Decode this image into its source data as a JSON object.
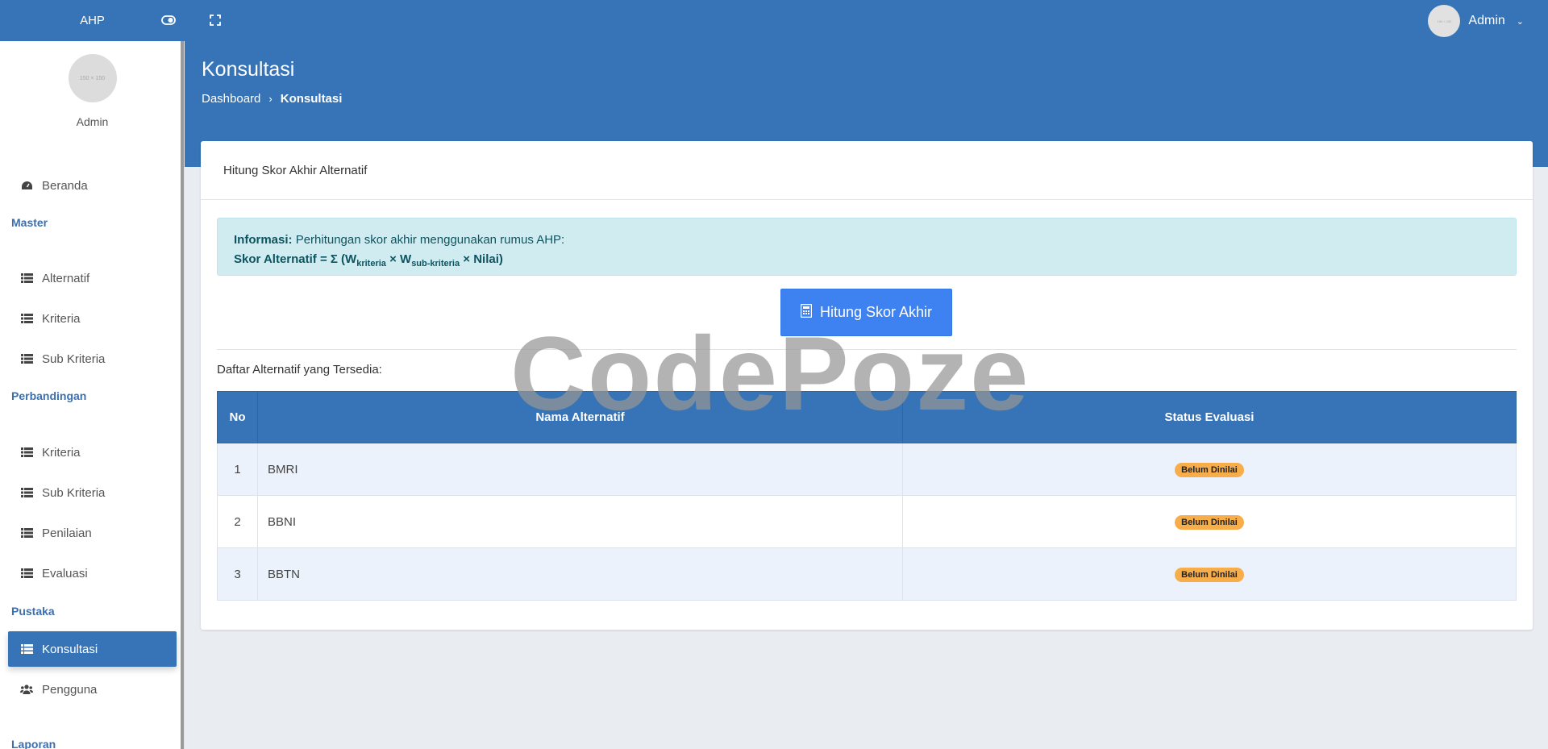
{
  "app": {
    "brand": "AHP"
  },
  "topbar": {
    "user_name": "Admin",
    "avatar_text": "150 × 150"
  },
  "sidebar": {
    "profile_avatar_text": "150 × 150",
    "profile_name": "Admin",
    "beranda": "Beranda",
    "section_master": "Master",
    "master_items": [
      "Alternatif",
      "Kriteria",
      "Sub Kriteria"
    ],
    "section_perbandingan": "Perbandingan",
    "perbandingan_items": [
      "Kriteria",
      "Sub Kriteria",
      "Penilaian",
      "Evaluasi"
    ],
    "section_pustaka": "Pustaka",
    "pustaka_items": [
      "Konsultasi",
      "Pengguna"
    ],
    "section_laporan": "Laporan"
  },
  "header": {
    "title": "Konsultasi",
    "breadcrumb": [
      "Dashboard",
      "Konsultasi"
    ]
  },
  "card": {
    "title": "Hitung Skor Akhir Alternatif",
    "alert": {
      "label": "Informasi:",
      "text": "Perhitungan skor akhir menggunakan rumus AHP:",
      "formula_label": "Skor Alternatif",
      "formula_eq": " = Σ (W",
      "sub1": "kriteria",
      "times1": " × W",
      "sub2": "sub-kriteria",
      "formula_end": " × Nilai)"
    },
    "button_label": "Hitung Skor Akhir",
    "list_label": "Daftar Alternatif yang Tersedia:",
    "table": {
      "headers": [
        "No",
        "Nama Alternatif",
        "Status Evaluasi"
      ],
      "rows": [
        {
          "no": "1",
          "name": "BMRI",
          "status": "Belum Dinilai"
        },
        {
          "no": "2",
          "name": "BBNI",
          "status": "Belum Dinilai"
        },
        {
          "no": "3",
          "name": "BBTN",
          "status": "Belum Dinilai"
        }
      ]
    }
  },
  "watermark": "CodePoze",
  "colors": {
    "primary": "#3674b7",
    "button": "#3d82f0",
    "badge": "#f6ad4a",
    "alert_bg": "#d1ecf1"
  }
}
